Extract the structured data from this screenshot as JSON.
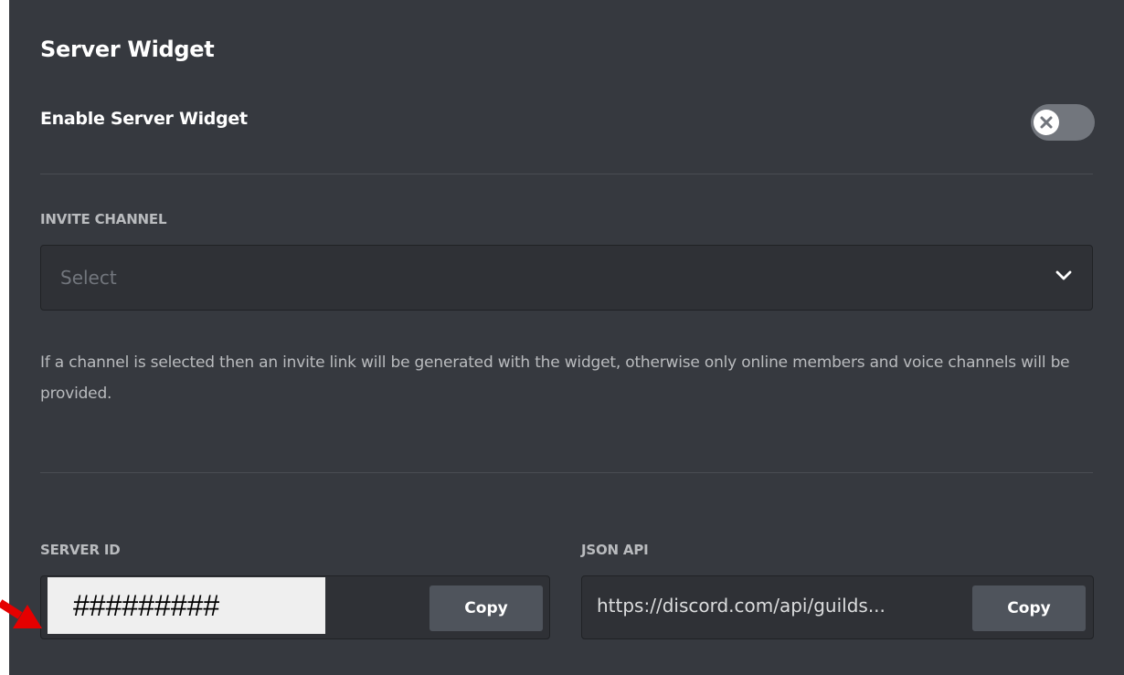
{
  "title": "Server Widget",
  "enable_widget": {
    "label": "Enable Server Widget",
    "enabled": false
  },
  "invite_channel": {
    "label": "INVITE CHANNEL",
    "placeholder": "Select"
  },
  "help_text": "If a channel is selected then an invite link will be generated with the widget, otherwise only online members and voice channels will be provided.",
  "server_id": {
    "label": "SERVER ID",
    "value": "#########",
    "copy_label": "Copy"
  },
  "json_api": {
    "label": "JSON API",
    "value": "https://discord.com/api/guilds...",
    "copy_label": "Copy"
  },
  "colors": {
    "background": "#36393f",
    "input_background": "#2f3136",
    "button": "#4f545c",
    "annotation_arrow": "#e50000"
  },
  "icons": [
    "close-icon",
    "chevron-down-icon",
    "annotation-arrow"
  ]
}
